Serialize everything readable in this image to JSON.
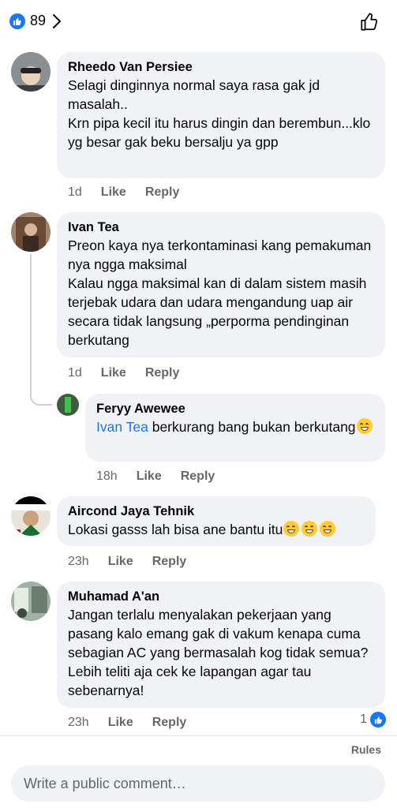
{
  "header": {
    "reaction_count": "89"
  },
  "comments": [
    {
      "author": "Rheedo Van Persiee",
      "text": "Selagi dinginnya normal saya rasa gak jd masalah..\nKrn pipa kecil itu harus dingin dan berembun...klo yg besar gak beku bersalju ya gpp",
      "time": "1d",
      "like": "Like",
      "reply": "Reply"
    },
    {
      "author": "Ivan Tea",
      "text": "Preon kaya nya terkontaminasi kang pemakuman nya ngga maksimal\nKalau ngga maksimal kan di dalam sistem masih terjebak udara dan udara mengandung uap air secara tidak langsung „perporma pendinginan berkutang",
      "time": "1d",
      "like": "Like",
      "reply": "Reply"
    },
    {
      "author": "Feryy Awewee",
      "mention": "Ivan Tea",
      "text": " berkurang bang bukan berkutang",
      "time": "18h",
      "like": "Like",
      "reply": "Reply"
    },
    {
      "author": "Aircond Jaya Tehnik",
      "text": "Lokasi gasss lah bisa ane bantu itu",
      "time": "23h",
      "like": "Like",
      "reply": "Reply"
    },
    {
      "author": "Muhamad A'an",
      "text": "Jangan terlalu menyalakan pekerjaan yang pasang kalo emang gak di vakum kenapa cuma sebagian AC yang bermasalah kog tidak semua? Lebih teliti aja cek ke lapangan agar tau sebenarnya!",
      "time": "23h",
      "like": "Like",
      "reply": "Reply",
      "reaction_count": "1"
    }
  ],
  "footer": {
    "rules": "Rules",
    "composer_placeholder": "Write a public comment…"
  },
  "colors": {
    "accent": "#1877f2",
    "bubble": "#f0f2f5",
    "muted": "#65676b"
  },
  "icons": [
    "like-icon",
    "chevron-right-icon",
    "thumbs-up-outline-icon",
    "grinning-emoji-icon"
  ]
}
